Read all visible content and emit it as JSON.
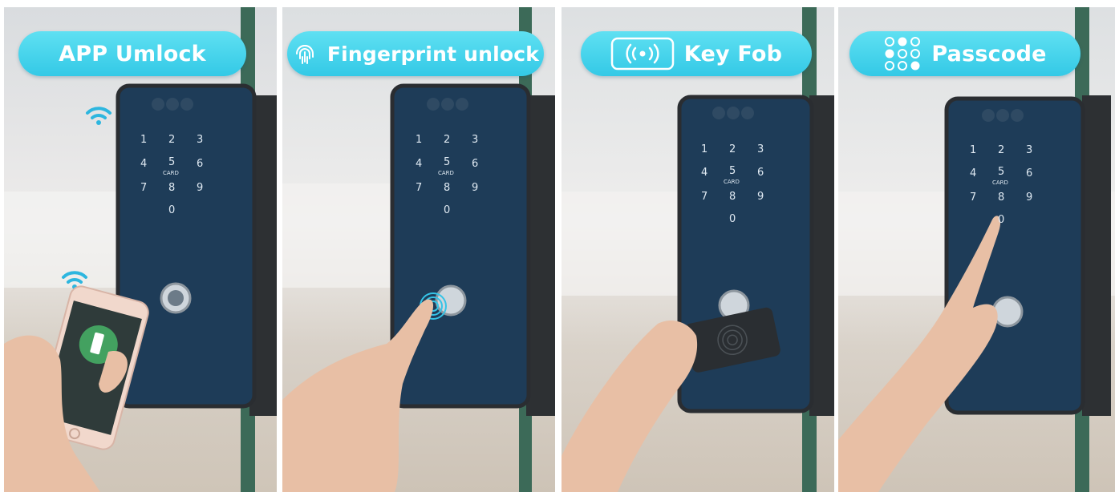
{
  "panels": [
    {
      "label": "APP Umlock",
      "icon": "phone-wifi-icon"
    },
    {
      "label": "Fingerprint unlock",
      "icon": "fingerprint-icon"
    },
    {
      "label": "Key Fob",
      "icon": "rfid-signal-icon"
    },
    {
      "label": "Passcode",
      "icon": "keypad-dots-icon"
    }
  ],
  "keypad": {
    "row1": [
      "1",
      "2",
      "3"
    ],
    "row2": [
      "4",
      "5",
      "6"
    ],
    "row3": [
      "7",
      "8",
      "9"
    ],
    "row4": [
      "0"
    ],
    "card_label": "CARD"
  },
  "colors": {
    "pill": "#33c9e6",
    "lock_body": "#1e3c58",
    "background": "#e9e6e1",
    "glass_edge": "#3f6f5f"
  }
}
